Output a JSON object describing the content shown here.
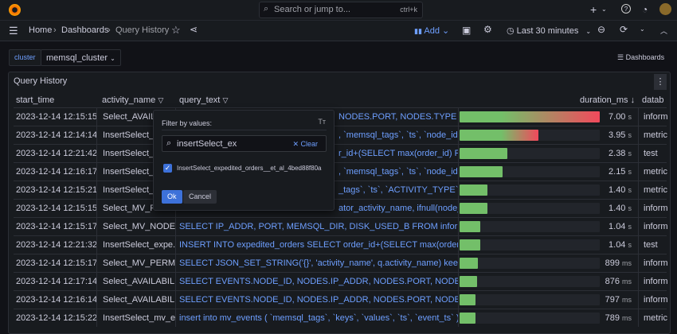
{
  "topbar": {
    "search_placeholder": "Search or jump to...",
    "shortcut": "ctrl+k",
    "plus": "+"
  },
  "breadcrumb": [
    "Home",
    "Dashboards",
    "Query History"
  ],
  "toolbar": {
    "add_label": "Add",
    "time_range": "Last 30 minutes"
  },
  "variable": {
    "label": "cluster",
    "value": "memsql_cluster"
  },
  "dashboards_link": "Dashboards",
  "panel": {
    "title": "Query History",
    "columns": [
      "start_time",
      "activity_name",
      "query_text",
      "duration_ms",
      "datab"
    ]
  },
  "rows": [
    {
      "start_time": "2023-12-14 12:15:15",
      "activity_name": "Select_AVAILA",
      "query_text": "NODES.PORT, NODES.TYPE AS...",
      "duration": "7.00",
      "unit": "s",
      "fraction": 1.0,
      "database": "inform"
    },
    {
      "start_time": "2023-12-14 12:14:14",
      "activity_name": "InsertSelect_q",
      "query_text": ", `memsql_tags`, `ts`, `node_id...",
      "duration": "3.95",
      "unit": "s",
      "fraction": 0.564,
      "database": "metric"
    },
    {
      "start_time": "2023-12-14 12:21:42",
      "activity_name": "InsertSelect_e",
      "query_text": "r_id+(SELECT max(order_id) FR...",
      "duration": "2.38",
      "unit": "s",
      "fraction": 0.34,
      "database": "test"
    },
    {
      "start_time": "2023-12-14 12:16:17",
      "activity_name": "InsertSelect_q",
      "query_text": ", `memsql_tags`, `ts`, `node_id...",
      "duration": "2.15",
      "unit": "s",
      "fraction": 0.307,
      "database": "metric"
    },
    {
      "start_time": "2023-12-14 12:15:21",
      "activity_name": "InsertSelect_a",
      "query_text": "_tags`, `ts`, `ACTIVITY_TYPE`, ...",
      "duration": "1.40",
      "unit": "s",
      "fraction": 0.2,
      "database": "metric"
    },
    {
      "start_time": "2023-12-14 12:15:15",
      "activity_name": "Select_MV_PEF",
      "query_text": "ator_activity_name, ifnull(node_...",
      "duration": "1.40",
      "unit": "s",
      "fraction": 0.2,
      "database": "inform"
    },
    {
      "start_time": "2023-12-14 12:15:17",
      "activity_name": "Select_MV_NODE...",
      "query_text": "SELECT IP_ADDR, PORT, MEMSQL_DIR, DISK_USED_B FROM information_sc...",
      "duration": "1.04",
      "unit": "s",
      "fraction": 0.149,
      "database": "inform"
    },
    {
      "start_time": "2023-12-14 12:21:32",
      "activity_name": "InsertSelect_expe...",
      "query_text": "INSERT INTO expedited_orders SELECT order_id+(SELECT max(order_id) FR...",
      "duration": "1.04",
      "unit": "s",
      "fraction": 0.149,
      "database": "test"
    },
    {
      "start_time": "2023-12-14 12:15:17",
      "activity_name": "Select_MV_PERMI...",
      "query_text": "SELECT JSON_SET_STRING('{}', 'activity_name', q.activity_name) keeys, JSO...",
      "duration": "899",
      "unit": "ms",
      "fraction": 0.128,
      "database": "inform"
    },
    {
      "start_time": "2023-12-14 12:17:14",
      "activity_name": "Select_AVAILABILI...",
      "query_text": "SELECT EVENTS.NODE_ID, NODES.IP_ADDR, NODES.PORT, NODES.TYPE AS...",
      "duration": "876",
      "unit": "ms",
      "fraction": 0.125,
      "database": "inform"
    },
    {
      "start_time": "2023-12-14 12:16:14",
      "activity_name": "Select_AVAILABILI...",
      "query_text": "SELECT EVENTS.NODE_ID, NODES.IP_ADDR, NODES.PORT, NODES.TYPE AS...",
      "duration": "797",
      "unit": "ms",
      "fraction": 0.114,
      "database": "inform"
    },
    {
      "start_time": "2023-12-14 12:15:22",
      "activity_name": "InsertSelect_mv_e...",
      "query_text": "insert into mv_events ( `memsql_tags`, `keys`, `values`, `ts`, `event_ts` ) s...",
      "duration": "789",
      "unit": "ms",
      "fraction": 0.113,
      "database": "metric"
    }
  ],
  "filter_popup": {
    "title": "Filter by values:",
    "search_value": "insertSelect_ex",
    "clear_label": "Clear",
    "option": "InsertSelect_expedited_orders__et_al_4bed88f80a",
    "option_checked": true,
    "ok_label": "Ok",
    "cancel_label": "Cancel"
  },
  "colors": {
    "accent": "#6e9fff",
    "bar_green": "#73bf69",
    "bar_red": "#f2495c",
    "primary_button": "#3d71d9"
  }
}
